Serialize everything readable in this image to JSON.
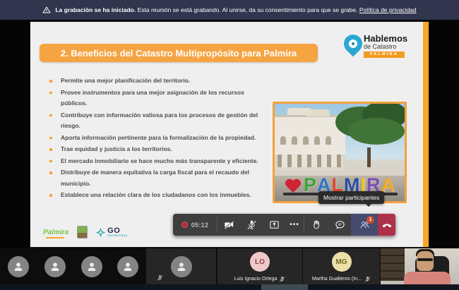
{
  "banner": {
    "bold": "La grabación se ha iniciado.",
    "text": "Esta reunión se está grabando. Al unirse, da su consentimiento para que se grabe.",
    "link": "Política de privacidad"
  },
  "slide": {
    "title": "2. Beneficios del Catastro Multipropósito para Palmira",
    "logo": {
      "line1": "Hablemos",
      "line2": "de Catastro",
      "badge": "PALMIRA"
    },
    "bullets": [
      "Permite una mejor planificación del territorio.",
      "Provee instrumentos para una mejor asignación de los recursos públicos.",
      "Contribuye con información valiosa para los procesos de gestión del riesgo.",
      "Aporta información pertinente para la formalización de la propiedad.",
      "Trae equidad y justicia a los territorios.",
      "El mercado inmobiliario se hace mucho más transparente y eficiente.",
      "Distribuye de manera equitativa la carga fiscal para el recaudo del municipio.",
      "Establece una relación clara de los ciudadanos con los inmuebles."
    ],
    "photo": {
      "letters": [
        "P",
        "A",
        "L",
        "M",
        "I",
        "R",
        "A"
      ]
    },
    "footer_logos": {
      "script": "Palmira",
      "go_main": "GO",
      "go_sub": "CATASTRAL"
    }
  },
  "toolbar": {
    "timer": "05:12",
    "more_label": "•••",
    "participants_badge": "1",
    "tooltip": "Mostrar participantes"
  },
  "filmstrip": {
    "tiles": [
      {
        "type": "avatar"
      },
      {
        "type": "avatar"
      },
      {
        "type": "avatar"
      },
      {
        "type": "avatar"
      },
      {
        "type": "avatar-muted"
      },
      {
        "type": "initials",
        "initials": "LO",
        "name": "Luis Ignacio Ortega"
      },
      {
        "type": "initials",
        "initials": "MG",
        "name": "Martha Gualteros (In…"
      },
      {
        "type": "video"
      }
    ]
  },
  "colors": {
    "accent_orange": "#F6A441",
    "banner_bg": "#31354E",
    "toolbar_bg": "#3E3E3E",
    "people_highlight": "#464B6F",
    "badge_orange": "#CA4A2E",
    "hangup_red": "#AD3148"
  }
}
